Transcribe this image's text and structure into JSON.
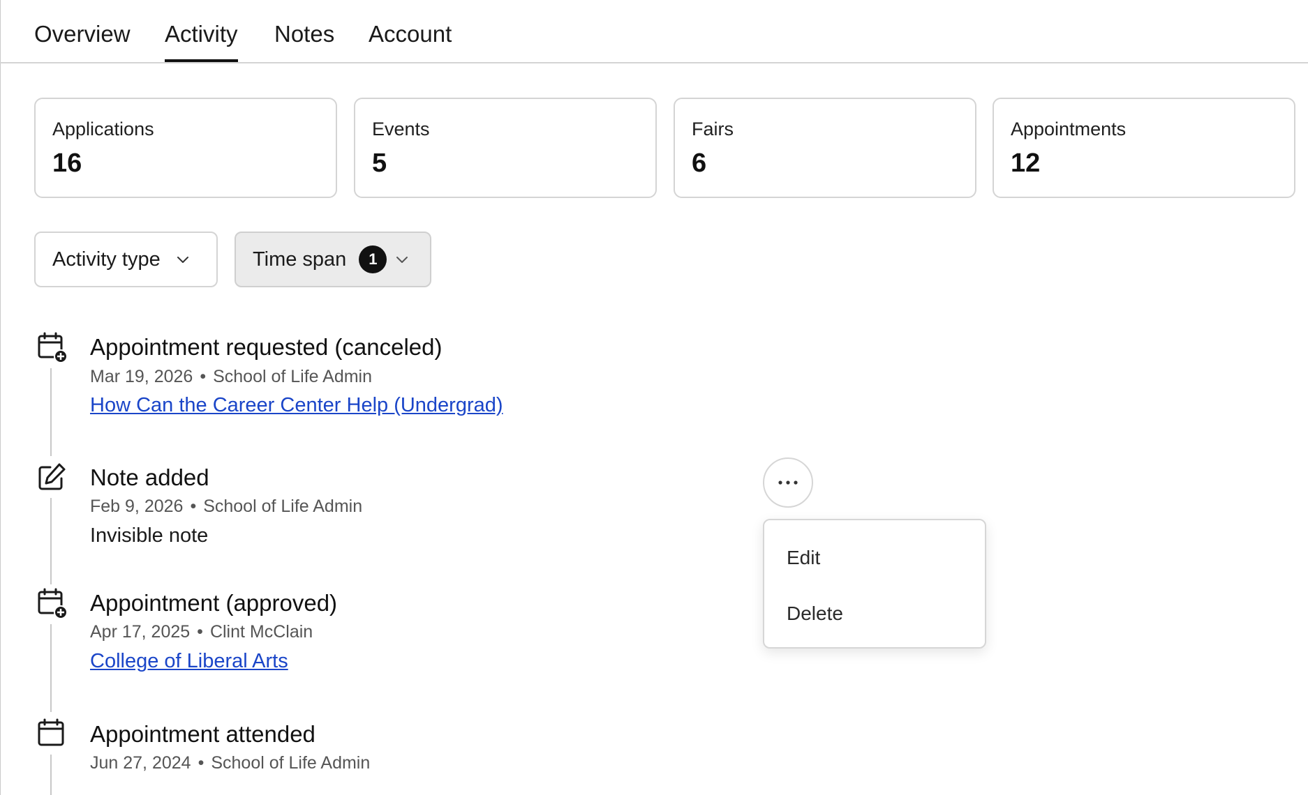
{
  "tabs": [
    {
      "label": "Overview"
    },
    {
      "label": "Activity",
      "active": true
    },
    {
      "label": "Notes"
    },
    {
      "label": "Account"
    }
  ],
  "stats": [
    {
      "label": "Applications",
      "value": "16"
    },
    {
      "label": "Events",
      "value": "5"
    },
    {
      "label": "Fairs",
      "value": "6"
    },
    {
      "label": "Appointments",
      "value": "12"
    }
  ],
  "filters": {
    "activity_type": {
      "label": "Activity type",
      "icon": "chevron-down-icon"
    },
    "time_span": {
      "label": "Time span",
      "badge": "1",
      "icon": "chevron-down-icon"
    }
  },
  "timeline": [
    {
      "icon": "calendar-plus-icon",
      "title": "Appointment requested (canceled)",
      "date": "Mar 19, 2026",
      "separator": "•",
      "actor": "School of Life Admin",
      "link": "How Can the Career Center Help (Undergrad)"
    },
    {
      "icon": "edit-note-icon",
      "title": "Note added",
      "date": "Feb 9, 2026",
      "separator": "•",
      "actor": "School of Life Admin",
      "text": "Invisible note"
    },
    {
      "icon": "calendar-plus-icon",
      "title": "Appointment (approved)",
      "date": "Apr 17, 2025",
      "separator": "•",
      "actor": "Clint McClain",
      "link": "College of Liberal Arts"
    },
    {
      "icon": "calendar-icon",
      "title": "Appointment attended",
      "date": "Jun 27, 2024",
      "separator": "•",
      "actor": "School of Life Admin"
    }
  ],
  "more_menu": {
    "icon": "more-horizontal-icon",
    "items": [
      {
        "label": "Edit"
      },
      {
        "label": "Delete"
      }
    ]
  },
  "colors": {
    "link": "#1a45c8",
    "border": "#d4d4d4",
    "active_filter_bg": "#ebebeb",
    "badge_bg": "#111111"
  }
}
